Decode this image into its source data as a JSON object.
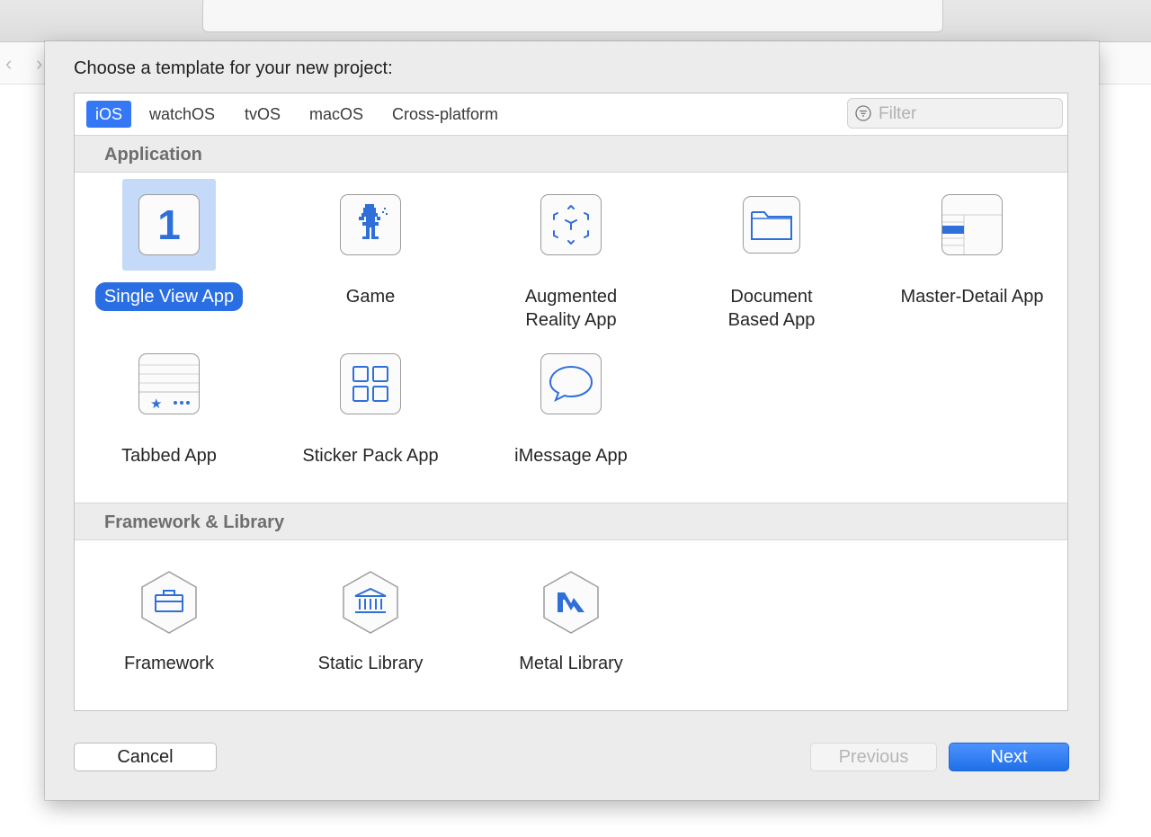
{
  "sheet": {
    "title": "Choose a template for your new project:"
  },
  "platform_tabs": [
    {
      "label": "iOS",
      "active": true
    },
    {
      "label": "watchOS",
      "active": false
    },
    {
      "label": "tvOS",
      "active": false
    },
    {
      "label": "macOS",
      "active": false
    },
    {
      "label": "Cross-platform",
      "active": false
    }
  ],
  "filter": {
    "placeholder": "Filter",
    "icon": "filter-icon"
  },
  "sections": {
    "application": {
      "title": "Application",
      "templates": [
        {
          "label": "Single View App",
          "icon": "single-view-app-icon",
          "icon_text": "1",
          "selected": true
        },
        {
          "label": "Game",
          "icon": "game-icon",
          "selected": false
        },
        {
          "label": "Augmented Reality App",
          "line1": "Augmented",
          "line2": "Reality App",
          "icon": "ar-app-icon",
          "selected": false
        },
        {
          "label": "Document Based App",
          "line1": "Document",
          "line2": "Based App",
          "icon": "document-app-icon",
          "selected": false
        },
        {
          "label": "Master-Detail App",
          "icon": "master-detail-icon",
          "selected": false
        },
        {
          "label": "Tabbed App",
          "icon": "tabbed-app-icon",
          "selected": false
        },
        {
          "label": "Sticker Pack App",
          "icon": "sticker-pack-icon",
          "selected": false
        },
        {
          "label": "iMessage App",
          "icon": "imessage-app-icon",
          "selected": false
        }
      ]
    },
    "framework": {
      "title": "Framework & Library",
      "templates": [
        {
          "label": "Framework",
          "icon": "framework-icon"
        },
        {
          "label": "Static Library",
          "icon": "static-library-icon"
        },
        {
          "label": "Metal Library",
          "icon": "metal-library-icon"
        }
      ]
    }
  },
  "buttons": {
    "cancel": "Cancel",
    "previous": "Previous",
    "next": "Next"
  },
  "colors": {
    "accent": "#3478f6",
    "selection": "#2a6ee3",
    "icon_blue": "#2f6fd9"
  }
}
